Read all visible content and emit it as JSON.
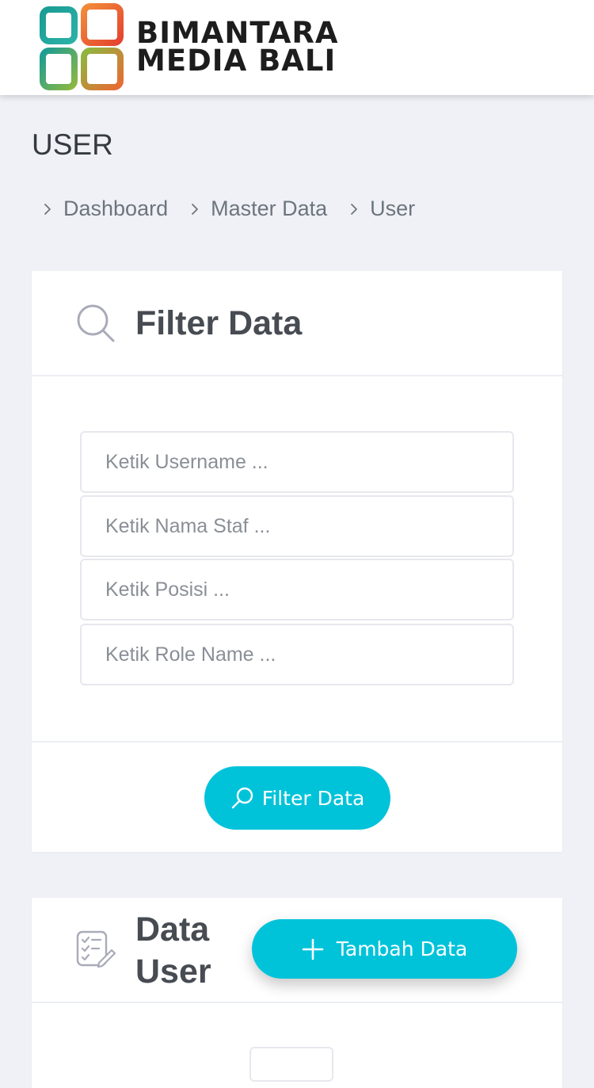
{
  "brand": {
    "line1": "BIMANTARA",
    "line2": "MEDIA BALI",
    "colors": {
      "teal": "#1a9c95",
      "green": "#8cb840",
      "orange": "#f0783a",
      "red": "#e4432f"
    }
  },
  "page": {
    "title": "USER"
  },
  "breadcrumb": [
    {
      "label": "Dashboard",
      "icon": "chevron-right-icon"
    },
    {
      "label": "Master Data",
      "icon": "chevron-right-icon"
    },
    {
      "label": "User",
      "icon": "chevron-right-icon"
    }
  ],
  "filter_card": {
    "icon": "search-icon",
    "title": "Filter Data",
    "fields": [
      {
        "name": "username",
        "value": "",
        "placeholder": "Ketik Username ..."
      },
      {
        "name": "nama_staf",
        "value": "",
        "placeholder": "Ketik Nama Staf ..."
      },
      {
        "name": "posisi",
        "value": "",
        "placeholder": "Ketik Posisi ..."
      },
      {
        "name": "role_name",
        "value": "",
        "placeholder": "Ketik Role Name ..."
      }
    ],
    "submit_label": "Filter Data",
    "submit_icon": "search-icon"
  },
  "data_card": {
    "icon": "checklist-edit-icon",
    "title": "Data User",
    "add_label": "Tambah Data",
    "add_icon": "plus-icon"
  },
  "colors": {
    "accent": "#00c3da",
    "background": "#f0f1f6",
    "title_text": "#474b52"
  }
}
